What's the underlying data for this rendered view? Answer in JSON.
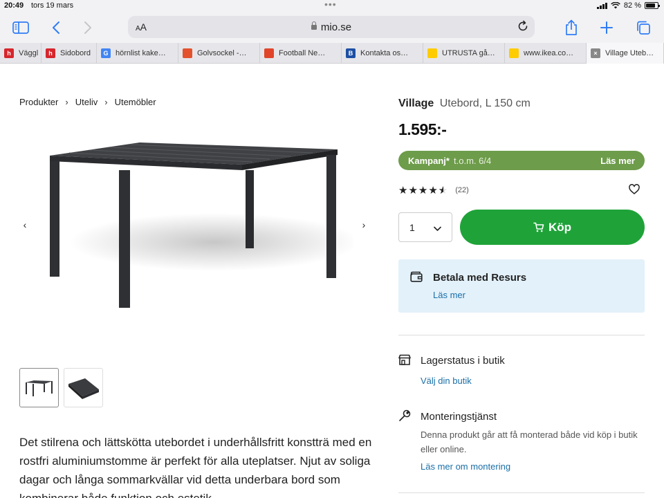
{
  "status_bar": {
    "time": "20:49",
    "date": "tors 19 mars",
    "battery_text": "82 %",
    "battery_level": 0.82
  },
  "browser": {
    "text_size_label": "AA",
    "url": "mio.se",
    "accent_color": "#2f7cf6",
    "tabs": [
      {
        "title": "Väggl",
        "favicon": "h",
        "favicon_color": "#d6262c"
      },
      {
        "title": "Sidobord",
        "favicon": "h",
        "favicon_color": "#d6262c"
      },
      {
        "title": "hörnlist kake…",
        "favicon": "G",
        "favicon_color": "#4285f4"
      },
      {
        "title": "Golvsockel -…",
        "favicon": "",
        "favicon_color": "#e3522d"
      },
      {
        "title": "Football Ne…",
        "favicon": "",
        "favicon_color": "#e0452a"
      },
      {
        "title": "Kontakta os…",
        "favicon": "B",
        "favicon_color": "#1e4fa3"
      },
      {
        "title": "UTRUSTA gå…",
        "favicon": "",
        "favicon_color": "#ffcc00"
      },
      {
        "title": "www.ikea.co…",
        "favicon": "",
        "favicon_color": "#ffcc00"
      },
      {
        "title": "Village Uteb…",
        "favicon": "×",
        "favicon_color": "#888888"
      }
    ]
  },
  "breadcrumb": [
    "Produkter",
    "Uteliv",
    "Utemöbler"
  ],
  "product": {
    "brand": "Village",
    "name": "Utebord, L 150 cm",
    "price": "1.595:-",
    "campaign": {
      "label": "Kampanj*",
      "date": "t.o.m. 6/4",
      "link": "Läs mer",
      "color": "#6d9c4a"
    },
    "rating": {
      "value": 4.5,
      "max": 5,
      "count": "(22)"
    },
    "quantity": "1",
    "buy_label": "Köp",
    "buy_color": "#1fa339",
    "description": "Det stilrena och lättskötta utebordet i underhållsfritt konstträ med en rostfri aluminiumstomme är perfekt för alla uteplatser. Njut av soliga dagar och långa sommarkvällar vid detta underbara bord som kombinerar både funktion och estetik."
  },
  "payment": {
    "title": "Betala med Resurs",
    "link": "Läs mer"
  },
  "store_stock": {
    "title": "Lagerstatus i butik",
    "link": "Välj din butik"
  },
  "assembly": {
    "title": "Monteringstjänst",
    "description": "Denna produkt går att få monterad både vid köp i butik eller online.",
    "link": "Läs mer om montering"
  },
  "link_color": "#1a6fa8"
}
